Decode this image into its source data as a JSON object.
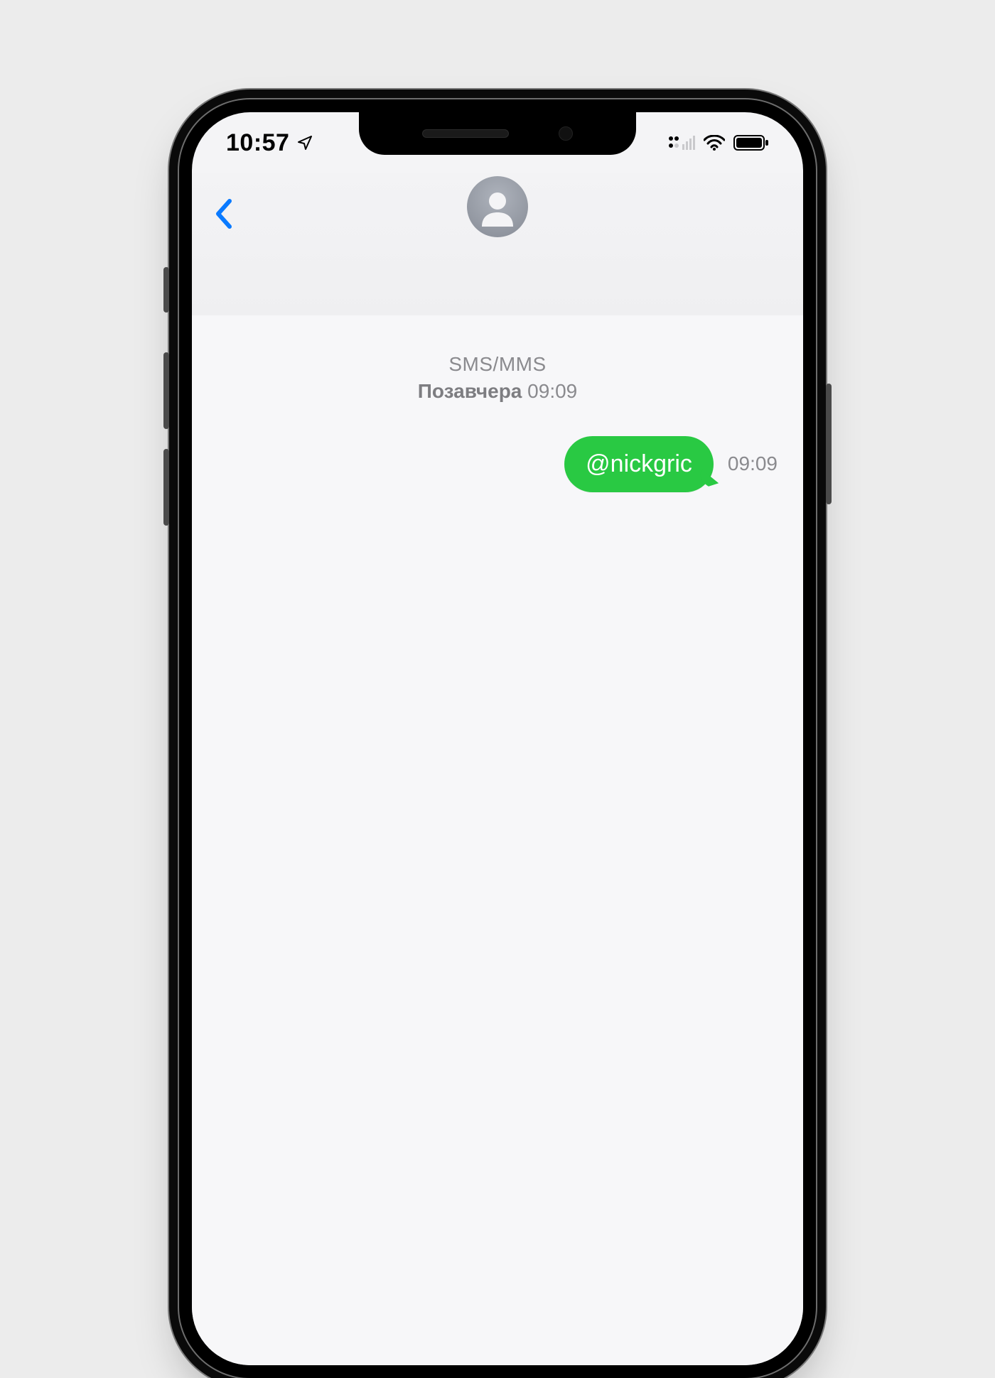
{
  "status": {
    "time": "10:57",
    "location_icon": "location-arrow-icon",
    "signal_icon": "dual-sim-signal-icon",
    "wifi_icon": "wifi-icon",
    "battery_icon": "battery-icon"
  },
  "header": {
    "back_icon": "chevron-left-icon",
    "avatar_icon": "person-silhouette-icon"
  },
  "conversation": {
    "channel_label": "SMS/MMS",
    "day_label": "Позавчера",
    "day_time": "09:09",
    "messages": [
      {
        "text": "@nickgric",
        "time": "09:09",
        "outgoing": true
      }
    ]
  },
  "colors": {
    "bubble_green": "#29c943",
    "accent_blue": "#0a7aff",
    "bg_page": "#ececec"
  }
}
